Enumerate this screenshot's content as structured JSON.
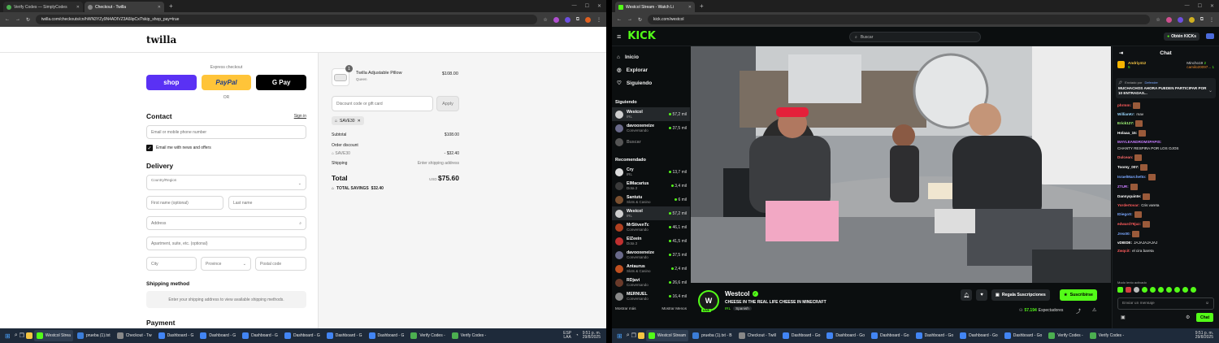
{
  "left_browser": {
    "tabs": [
      {
        "title": "Verify Codes — SimplyCodes",
        "active": false
      },
      {
        "title": "Checkout - Twilla",
        "active": true
      }
    ],
    "url": "twilla.com/checkouts/cn/hWN3YZy9N4ADIVZ3A6lipCxl?skip_shop_pay=true"
  },
  "checkout": {
    "brand": "twilla",
    "express_label": "Express checkout",
    "shop_label": "shop",
    "paypal_label": "PayPal",
    "gpay_label": "G Pay",
    "or_label": "OR",
    "contact_title": "Contact",
    "sign_in": "Sign in",
    "email_placeholder": "Email or mobile phone number",
    "news_label": "Email me with news and offers",
    "delivery_title": "Delivery",
    "country_label": "Country/Region",
    "first_name": "First name (optional)",
    "last_name": "Last name",
    "address": "Address",
    "apartment": "Apartment, suite, etc. (optional)",
    "city": "City",
    "province": "Province",
    "postal": "Postal code",
    "shipping_method_title": "Shipping method",
    "shipping_method_note": "Enter your shipping address to view available shipping methods.",
    "payment_title": "Payment"
  },
  "summary": {
    "qty_badge": "1",
    "item_name": "Twilla Adjustable Pillow",
    "item_variant": "Queen",
    "item_price": "$108.00",
    "discount_placeholder": "Discount code or gift card",
    "apply_label": "Apply",
    "code_chip": "SAVE30",
    "subtotal_label": "Subtotal",
    "subtotal_value": "$108.00",
    "order_discount_label": "Order discount",
    "code_line": "SAVE30",
    "discount_value": "- $32.40",
    "shipping_label": "Shipping",
    "shipping_value": "Enter shipping address",
    "total_label": "Total",
    "currency": "USD",
    "total_value": "$75.60",
    "savings_label": "TOTAL SAVINGS",
    "savings_value": "$32.40"
  },
  "right_browser": {
    "tabs": [
      {
        "title": "Westcol Stream - Watch Li",
        "active": true
      }
    ],
    "url": "kick.com/westcol"
  },
  "kick": {
    "logo": "KICK",
    "search_placeholder": "Buscar",
    "get_kicks": "Obtén KICKs",
    "nav": [
      "Inicio",
      "Explorar",
      "Siguiendo"
    ],
    "following_title": "Siguiendo",
    "following": [
      {
        "name": "Westcol",
        "category": "IRL",
        "viewers": "57,2 mil",
        "color": "#cfcfcf",
        "live": true
      },
      {
        "name": "davooxeneize",
        "category": "Conversando",
        "viewers": "37,5 mil",
        "color": "#6a6a8a",
        "live": true
      },
      {
        "name": "Buscar",
        "category": "",
        "viewers": "",
        "color": "#555555",
        "live": false
      }
    ],
    "recommended_title": "Recomendado",
    "recommended": [
      {
        "name": "Cry",
        "category": "IRL",
        "viewers": "13,7 mil",
        "color": "#dcdcdc"
      },
      {
        "name": "ElMacarius",
        "category": "Dota 2",
        "viewers": "3,4 mil",
        "color": "#3a3a3a"
      },
      {
        "name": "Santutu",
        "category": "Slots & Casino",
        "viewers": "6 mil",
        "color": "#7a5030"
      },
      {
        "name": "Westcol",
        "category": "IRL",
        "viewers": "57,2 mil",
        "color": "#cfcfcf"
      },
      {
        "name": "MrStivenTc",
        "category": "Conversando",
        "viewers": "46,1 mil",
        "color": "#b04020"
      },
      {
        "name": "ElZeein",
        "category": "Dota 2",
        "viewers": "41,5 mil",
        "color": "#c03030"
      },
      {
        "name": "davooxeneize",
        "category": "Conversando",
        "viewers": "37,5 mil",
        "color": "#6a6a8a"
      },
      {
        "name": "Antaurus",
        "category": "Slots & Casino",
        "viewers": "2,4 mil",
        "color": "#c05020"
      },
      {
        "name": "RDjavi",
        "category": "Conversando",
        "viewers": "26,6 mil",
        "color": "#6a3a2a"
      },
      {
        "name": "MERNUEL",
        "category": "Conversando",
        "viewers": "16,4 mil",
        "color": "#888888"
      }
    ],
    "show_more": "Mostrar más",
    "show_less": "Mostrar Menos",
    "streamer": "Westcol",
    "stream_title": "CHEESE IN THE REAL LIFE CHEESE IN MINECRAFT",
    "stream_category": "IRL",
    "stream_lang": "Spanish",
    "gift_subs": "Regala Suscripciones",
    "subscribe": "Suscribirse",
    "viewer_count": "57.194",
    "viewers_label": "Espectadores",
    "live_badge": "LIVE",
    "chat": {
      "title": "Chat",
      "top_gifters": [
        {
          "name": "Andriy412",
          "value": "5"
        },
        {
          "name": "Mincho19",
          "value": "2"
        },
        {
          "name": "camilo20097...",
          "value": "1"
        }
      ],
      "pinned_by": "Enviado por",
      "pinned_user": "Defender",
      "pinned_text": "MUCHACHOS AHORA PUEDEN PARTICIPAR POR 10 ENTRADAS...",
      "messages": [
        {
          "user": "phrmm:",
          "text": "",
          "color": "#ff5c5c",
          "emote": true
        },
        {
          "user": "WillianKr:",
          "text": "mav",
          "color": "#9ad7ff",
          "emote": false
        },
        {
          "user": "Erick127:",
          "text": "",
          "color": "#a6ff7a",
          "emote": true
        },
        {
          "user": "Holaaa_15:",
          "text": "",
          "color": "#ffffff",
          "emote": true
        },
        {
          "user": "MAYLEANDROMSPAPIS:",
          "text": "CHANTY RESPIRA POR LOS OJOS",
          "color": "#c77dff",
          "emote": false
        },
        {
          "user": "Dulcean:",
          "text": "",
          "color": "#ff6b6b",
          "emote": true
        },
        {
          "user": "Toomy_007:",
          "text": "",
          "color": "#ffffff",
          "emote": true
        },
        {
          "user": "IsraelMarchetto:",
          "text": "",
          "color": "#7aa7ff",
          "emote": true
        },
        {
          "user": "ZTUR:",
          "text": "",
          "color": "#c77dff",
          "emote": true
        },
        {
          "user": "Dannyquinte:",
          "text": "",
          "color": "#ffffff",
          "emote": true
        },
        {
          "user": "Yordertovar:",
          "text": "Cris vareta",
          "color": "#ff5c5c",
          "emote": false
        },
        {
          "user": "IDiegoS:",
          "text": "",
          "color": "#7aa7ff",
          "emote": true
        },
        {
          "user": "edward79juz:",
          "text": "",
          "color": "#ff5c5c",
          "emote": true
        },
        {
          "user": "Jrex00:",
          "text": "",
          "color": "#7aa7ff",
          "emote": true
        },
        {
          "user": "vDIEDE:",
          "text": "JAJAJAJAJAJ",
          "color": "#ffffff",
          "emote": false
        },
        {
          "user": "Zwqcit:",
          "text": "el cira bareta",
          "color": "#ff5c5c",
          "emote": false
        }
      ],
      "mode_note": "Modo lento activado",
      "input_placeholder": "Enviar un mensaje",
      "send_label": "Chat"
    }
  },
  "taskbar_left": {
    "items": [
      "Westcol Strea",
      "prueba (1).txt",
      "Checkout - Tw",
      "Dashboard - G",
      "Dashboard - G",
      "Dashboard - G",
      "Dashboard - G",
      "Dashboard - G",
      "Dashboard - G",
      "Verify Codes -",
      "Verify Codes -"
    ],
    "lang": "ESP",
    "region": "LAA",
    "time": "9:51 p. m.",
    "date": "29/8/2025"
  },
  "taskbar_right": {
    "items": [
      "Westcol Stream",
      "prueba (1).txt - B",
      "Checkout - Twill",
      "Dashboard - Go",
      "Dashboard - Go",
      "Dashboard - Go",
      "Dashboard - Go",
      "Dashboard - Go",
      "Dashboard - Go",
      "Verify Codes -",
      "Verify Codes -"
    ],
    "time": "9:51 p. m.",
    "date": "29/8/2025"
  },
  "colors": {
    "kick_green": "#53fc18",
    "paypal_yellow": "#ffc439",
    "shop_purple": "#5a31f4"
  }
}
